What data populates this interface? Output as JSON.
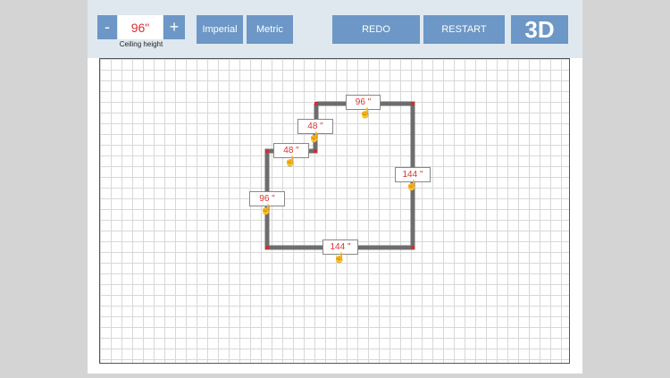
{
  "toolbar": {
    "minus_label": "-",
    "plus_label": "+",
    "ceiling_height_value": "96\"",
    "ceiling_height_label": "Ceiling height",
    "imperial_label": "Imperial",
    "metric_label": "Metric",
    "redo_label": "REDO",
    "restart_label": "RESTART",
    "three_d_label": "3D"
  },
  "walls": [
    {
      "id": "top",
      "length_label": "96 \""
    },
    {
      "id": "step-upper",
      "length_label": "48 \""
    },
    {
      "id": "step-lower",
      "length_label": "48 \""
    },
    {
      "id": "right",
      "length_label": "144 \""
    },
    {
      "id": "left",
      "length_label": "96 \""
    },
    {
      "id": "bottom",
      "length_label": "144 \""
    }
  ],
  "icons": {
    "drag_handle": "hand-pointer-icon"
  },
  "colors": {
    "button": "#6c97c6",
    "wall": "#6d6d6d",
    "corner": "#c83232",
    "dimension_text": "#e03030"
  }
}
